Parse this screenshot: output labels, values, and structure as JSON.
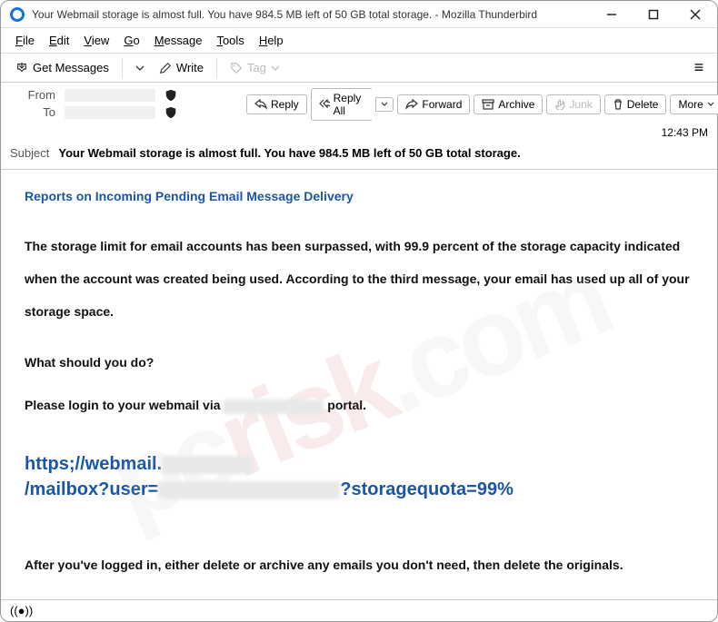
{
  "window": {
    "title": "Your Webmail storage is almost full. You have 984.5 MB left of 50 GB total storage. - Mozilla Thunderbird"
  },
  "menu": {
    "file": "File",
    "edit": "Edit",
    "view": "View",
    "go": "Go",
    "message": "Message",
    "tools": "Tools",
    "help": "Help"
  },
  "toolbar": {
    "get_messages": "Get Messages",
    "write": "Write",
    "tag": "Tag"
  },
  "headers": {
    "from_label": "From",
    "to_label": "To",
    "subject_label": "Subject",
    "subject_value": "Your Webmail storage is almost full. You have 984.5 MB left of 50 GB total storage.",
    "timestamp": "12:43 PM"
  },
  "actions": {
    "reply": "Reply",
    "reply_all": "Reply All",
    "forward": "Forward",
    "archive": "Archive",
    "junk": "Junk",
    "delete": "Delete",
    "more": "More"
  },
  "body": {
    "heading": "Reports on Incoming Pending Email Message Delivery",
    "p1": "The storage limit for email accounts has been surpassed, with 99.9 percent of the storage capacity indicated when the account was created being used. According to the third message, your email has used up all of your storage space.",
    "q": "What should you do?",
    "p2a": "Please login to your webmail via ",
    "p2b": " portal.",
    "link1": "https;//webmail.",
    "link2": "/mailbox?user=",
    "link3": "?storagequota=99%",
    "p3": "After you've logged in, either delete or archive any emails you don't need, then delete the originals."
  }
}
